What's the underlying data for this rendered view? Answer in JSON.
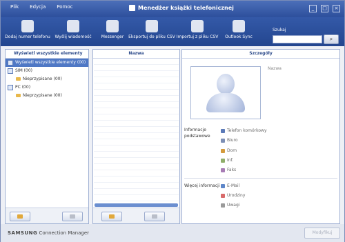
{
  "menu": [
    "Plik",
    "Edycja",
    "Pomoc"
  ],
  "window": {
    "title": "Menedżer książki telefonicznej",
    "min": "_",
    "max": "□",
    "close": "×"
  },
  "toolbar": {
    "add_contact": "Dodaj numer telefonu",
    "send_message": "Wyślij wiadomość",
    "messenger": "Messenger",
    "export_csv": "Eksportuj do pliku CSV",
    "import_csv": "Importuj z pliku CSV",
    "outlook_sync": "Outlook Sync"
  },
  "search": {
    "label": "Szukaj",
    "value": "",
    "button": "⌕"
  },
  "left_panel": {
    "header": "Wyświetl wszystkie elementy",
    "items": [
      {
        "label": "Wyświetl wszystkie elementy (00)"
      },
      {
        "label": "SIM (00)"
      },
      {
        "label": "Nieprzypisane (00)"
      },
      {
        "label": "PC (00)"
      },
      {
        "label": "Nieprzypisane (00)"
      }
    ]
  },
  "middle_panel": {
    "header": "Nazwa"
  },
  "detail": {
    "header": "Szczegóły",
    "name_label": "Nazwa",
    "basic_info": "Informacje podstawowe",
    "fields_basic": [
      "Telefon komórkowy",
      "Biuro",
      "Dom",
      "Inf.",
      "Faks"
    ],
    "more_info": "Więcej informacji",
    "fields_more": [
      "E-Mail",
      "Urodziny",
      "Uwagi"
    ]
  },
  "footer": {
    "brand": "SAMSUNG",
    "product": "Connection Manager",
    "modify_button": "Modyfikuj"
  }
}
